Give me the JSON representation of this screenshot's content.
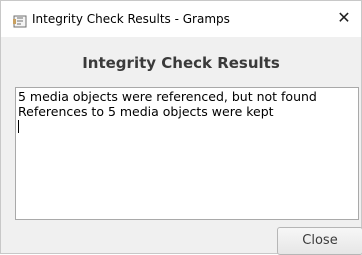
{
  "window": {
    "title": "Integrity Check Results - Gramps",
    "icon": "gramps-app-icon",
    "close_glyph": "✕"
  },
  "dialog": {
    "heading": "Integrity Check Results",
    "results_lines": [
      "5 media objects were referenced, but not found",
      "References to 5 media objects were kept"
    ],
    "close_label": "Close"
  }
}
